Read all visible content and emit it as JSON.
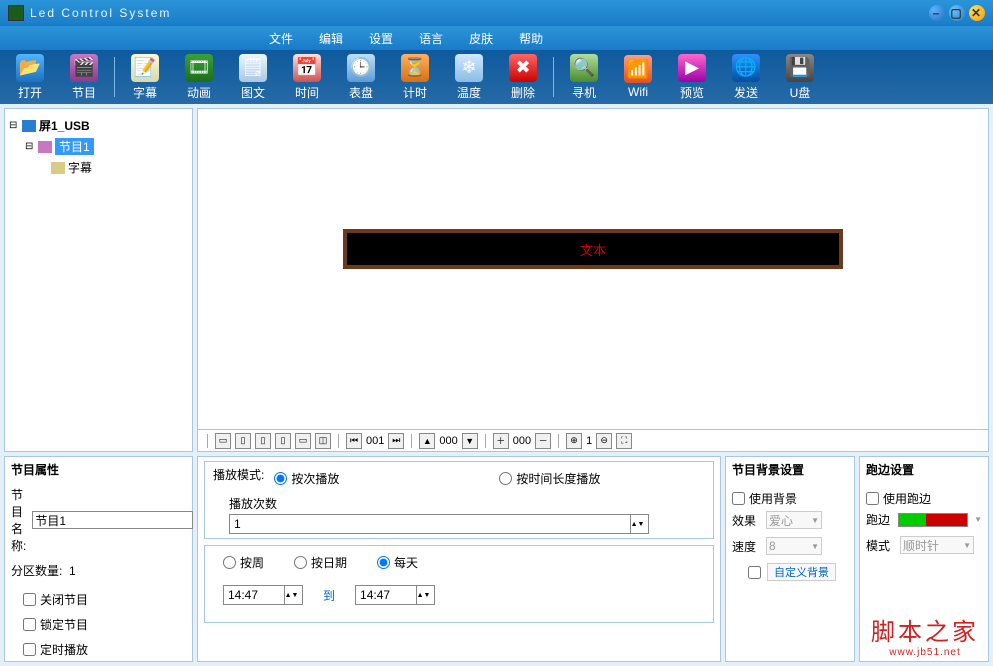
{
  "title": "Led Control System",
  "menu": [
    "文件",
    "编辑",
    "设置",
    "语言",
    "皮肤",
    "帮助"
  ],
  "toolbar": [
    {
      "g": 0,
      "label": "打开",
      "icon": "📂",
      "bg": "linear-gradient(#4fb7ff,#1e70c0)"
    },
    {
      "g": 0,
      "label": "节目",
      "icon": "🎬",
      "bg": "linear-gradient(#c977c3,#8a3a8a)"
    },
    {
      "g": 1,
      "label": "字幕",
      "icon": "📝",
      "bg": "linear-gradient(#fafada,#d8d8a8)"
    },
    {
      "g": 1,
      "label": "动画",
      "icon": "🎞",
      "bg": "linear-gradient(#3aa03a,#1c6d1c)"
    },
    {
      "g": 1,
      "label": "图文",
      "icon": "🗒",
      "bg": "linear-gradient(#eef7ff,#a8c8e0)"
    },
    {
      "g": 1,
      "label": "时间",
      "icon": "📅",
      "bg": "linear-gradient(#ffe0e0,#d05050)"
    },
    {
      "g": 1,
      "label": "表盘",
      "icon": "🕒",
      "bg": "linear-gradient(#bde0ff,#5a9cd8)"
    },
    {
      "g": 1,
      "label": "计时",
      "icon": "⏳",
      "bg": "linear-gradient(#ffb060,#d87010)"
    },
    {
      "g": 1,
      "label": "温度",
      "icon": "❄",
      "bg": "linear-gradient(#d0e8ff,#8abce8)"
    },
    {
      "g": 1,
      "label": "删除",
      "icon": "✖",
      "bg": "linear-gradient(#ff6666,#c00)"
    },
    {
      "g": 2,
      "label": "寻机",
      "icon": "🔍",
      "bg": "linear-gradient(#b0e09c,#4a8a2c)"
    },
    {
      "g": 2,
      "label": "Wifi",
      "icon": "📶",
      "bg": "linear-gradient(#ff9c7a,#e05020)"
    },
    {
      "g": 2,
      "label": "预览",
      "icon": "▶",
      "bg": "linear-gradient(#ff66cc,#9c00aa)"
    },
    {
      "g": 2,
      "label": "发送",
      "icon": "🌐",
      "bg": "linear-gradient(#3090ff,#0050a0)"
    },
    {
      "g": 2,
      "label": "U盘",
      "icon": "💾",
      "bg": "linear-gradient(#888,#444)"
    }
  ],
  "tree": {
    "screen": "屏1_USB",
    "program": "节目1",
    "subtitle": "字幕"
  },
  "canvas_text": "文本",
  "mini": {
    "idx1": "001",
    "idx2": "000",
    "idx3": "000",
    "zoom": "1"
  },
  "prop": {
    "title": "节目属性",
    "name_label": "节目名称:",
    "name_value": "节目1",
    "count_label": "分区数量:",
    "count_value": "1",
    "close_label": "关闭节目",
    "lock_label": "锁定节目",
    "timed_label": "定时播放"
  },
  "play": {
    "mode_label": "播放模式:",
    "by_count": "按次播放",
    "by_time": "按时间长度播放",
    "count_label": "播放次数",
    "count_value": "1",
    "by_week": "按周",
    "by_date": "按日期",
    "daily": "每天",
    "to": "到",
    "t1": "14:47",
    "t2": "14:47"
  },
  "bg": {
    "title": "节目背景设置",
    "use_bg": "使用背景",
    "effect_label": "效果",
    "effect_value": "爱心",
    "speed_label": "速度",
    "speed_value": "8",
    "custom": "自定义背景"
  },
  "border": {
    "title": "跑边设置",
    "use_border": "使用跑边",
    "border_label": "跑边",
    "mode_label": "模式",
    "mode_value": "顺时针"
  },
  "watermark": {
    "big": "脚本之家",
    "small": "www.jb51.net"
  }
}
